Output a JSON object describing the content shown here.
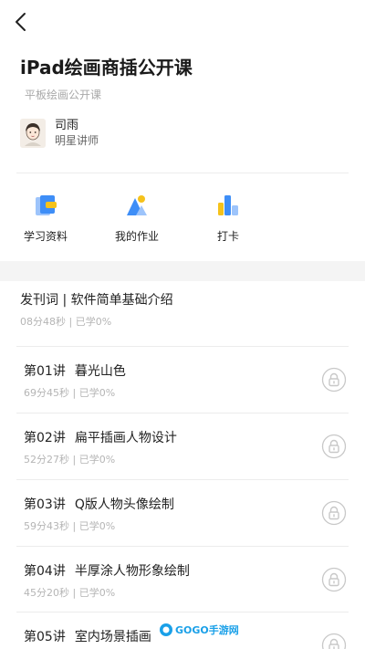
{
  "header": {
    "back_icon": "chevron-left-icon"
  },
  "course": {
    "title": "iPad绘画商插公开课",
    "subtitle": "平板绘画公开课"
  },
  "teacher": {
    "name": "司雨",
    "role": "明星讲师"
  },
  "actions": [
    {
      "label": "学习资料",
      "icon": "study-material-icon"
    },
    {
      "label": "我的作业",
      "icon": "homework-icon"
    },
    {
      "label": "打卡",
      "icon": "checkin-icon"
    }
  ],
  "intro": {
    "title": "发刊词 | 软件简单基础介绍",
    "meta": "08分48秒 | 已学0%"
  },
  "lessons": [
    {
      "number": "第01讲",
      "name": "暮光山色",
      "meta": "69分45秒 | 已学0%"
    },
    {
      "number": "第02讲",
      "name": "扁平插画人物设计",
      "meta": "52分27秒 | 已学0%"
    },
    {
      "number": "第03讲",
      "name": "Q版人物头像绘制",
      "meta": "59分43秒 | 已学0%"
    },
    {
      "number": "第04讲",
      "name": "半厚涂人物形象绘制",
      "meta": "45分20秒 | 已学0%"
    },
    {
      "number": "第05讲",
      "name": "室内场景插画",
      "meta": ""
    }
  ],
  "watermark": {
    "text": "GOGO手游网"
  },
  "colors": {
    "accent_blue": "#3e8ef7",
    "accent_yellow": "#f5c21b",
    "lock_gray": "#c8c8c8"
  }
}
